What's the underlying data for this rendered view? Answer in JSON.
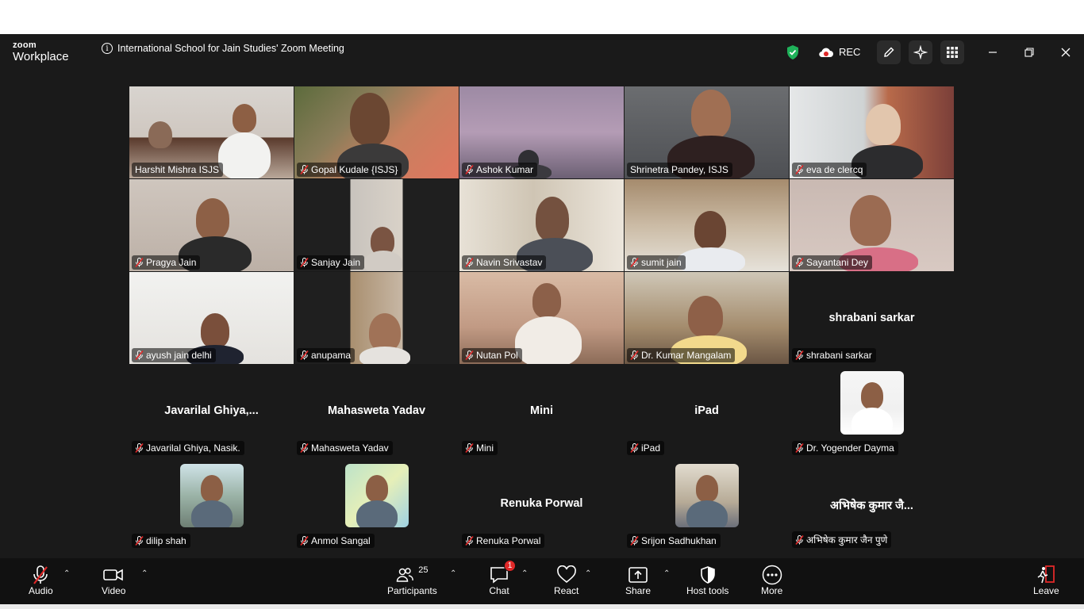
{
  "app": {
    "brand_small": "zoom",
    "brand_big": "Workplace",
    "meeting_title": "International School for Jain Studies' Zoom Meeting",
    "rec_label": "REC"
  },
  "tiles": [
    {
      "name": "Harshit Mishra ISJS",
      "muted": false,
      "kind": "video",
      "active": false
    },
    {
      "name": "Gopal Kudale {ISJS}",
      "muted": true,
      "kind": "video",
      "active": false
    },
    {
      "name": "Ashok Kumar",
      "muted": true,
      "kind": "video",
      "active": false
    },
    {
      "name": "Shrinetra Pandey, ISJS",
      "muted": false,
      "kind": "video",
      "active": true
    },
    {
      "name": "eva de clercq",
      "muted": true,
      "kind": "video",
      "active": false
    },
    {
      "name": "Pragya Jain",
      "muted": true,
      "kind": "video",
      "active": false
    },
    {
      "name": "Sanjay Jain",
      "muted": true,
      "kind": "video",
      "active": false
    },
    {
      "name": "Navin Srivastav",
      "muted": true,
      "kind": "video",
      "active": false
    },
    {
      "name": "sumit jain",
      "muted": true,
      "kind": "video",
      "active": false
    },
    {
      "name": "Sayantani Dey",
      "muted": true,
      "kind": "video",
      "active": false
    },
    {
      "name": "ayush jain delhi",
      "muted": true,
      "kind": "video",
      "active": false
    },
    {
      "name": "anupama",
      "muted": true,
      "kind": "video",
      "active": false
    },
    {
      "name": "Nutan Pol",
      "muted": true,
      "kind": "video",
      "active": false
    },
    {
      "name": "Dr. Kumar Mangalam",
      "muted": true,
      "kind": "video",
      "active": false
    },
    {
      "name": "shrabani sarkar",
      "muted": true,
      "kind": "text",
      "display": "shrabani sarkar"
    },
    {
      "name": "Javarilal Ghiya, Nasik.",
      "muted": true,
      "kind": "text",
      "display": "Javarilal  Ghiya,..."
    },
    {
      "name": "Mahasweta Yadav",
      "muted": true,
      "kind": "text",
      "display": "Mahasweta Yadav"
    },
    {
      "name": "Mini",
      "muted": true,
      "kind": "text",
      "display": "Mini"
    },
    {
      "name": "iPad",
      "muted": true,
      "kind": "text",
      "display": "iPad"
    },
    {
      "name": "Dr. Yogender Dayma",
      "muted": true,
      "kind": "avatar",
      "avatar": "portrait"
    },
    {
      "name": "dilip shah",
      "muted": true,
      "kind": "avatar",
      "avatar": "couple"
    },
    {
      "name": "Anmol Sangal",
      "muted": true,
      "kind": "avatar",
      "avatar": "cartoon"
    },
    {
      "name": "Renuka Porwal",
      "muted": true,
      "kind": "text",
      "display": "Renuka Porwal"
    },
    {
      "name": "Srijon Sadhukhan",
      "muted": true,
      "kind": "avatar",
      "avatar": "group"
    },
    {
      "name": "अभिषेक कुमार जैन पुणे",
      "muted": true,
      "kind": "text",
      "display": "अभिषेक कुमार जै..."
    }
  ],
  "toolbar": {
    "audio": "Audio",
    "video": "Video",
    "participants": "Participants",
    "participants_count": "25",
    "chat": "Chat",
    "chat_badge": "1",
    "react": "React",
    "share": "Share",
    "host_tools": "Host tools",
    "more": "More",
    "leave": "Leave"
  },
  "colors": {
    "active_speaker": "#23d959",
    "security_shield": "#1fb25a",
    "muted_red": "#e02828"
  }
}
